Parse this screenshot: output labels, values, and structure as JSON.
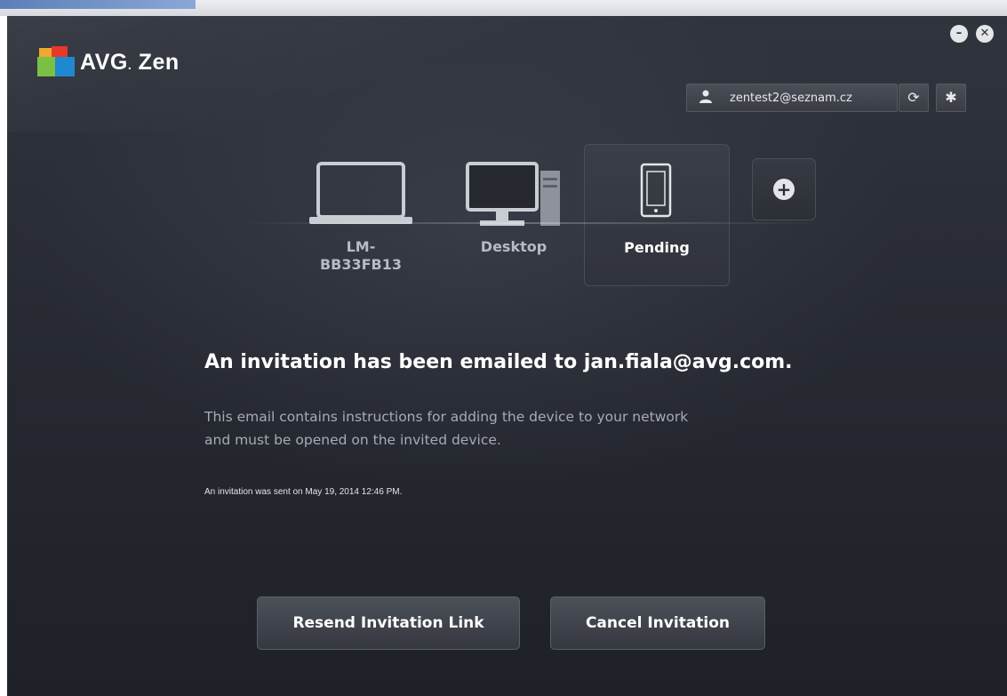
{
  "window": {
    "logo_text": "AVG",
    "logo_product": "Zen",
    "minimize_icon": "minus-icon",
    "close_icon": "close-icon"
  },
  "account": {
    "email": "zentest2@seznam.cz",
    "icon": "user-icon",
    "refresh_icon": "refresh-icon",
    "settings_icon": "gear-icon"
  },
  "devices": [
    {
      "label": "LM-\nBB33FB13",
      "icon": "laptop-icon",
      "selected": false
    },
    {
      "label": "Desktop",
      "icon": "desktop-icon",
      "selected": false
    },
    {
      "label": "Pending",
      "icon": "phone-icon",
      "selected": true
    }
  ],
  "add_device": {
    "icon": "plus-icon"
  },
  "message": {
    "headline": "An invitation has been emailed to jan.fiala@avg.com.",
    "description": "This email contains instructions for adding the device to your network and must be opened on the invited device.",
    "sent_note": "An invitation was sent on May 19, 2014 12:46 PM."
  },
  "actions": {
    "resend_label": "Resend Invitation Link",
    "cancel_label": "Cancel Invitation"
  },
  "colors": {
    "background": "#272a32",
    "text_primary": "#ffffff",
    "text_secondary": "#a7abb3"
  }
}
